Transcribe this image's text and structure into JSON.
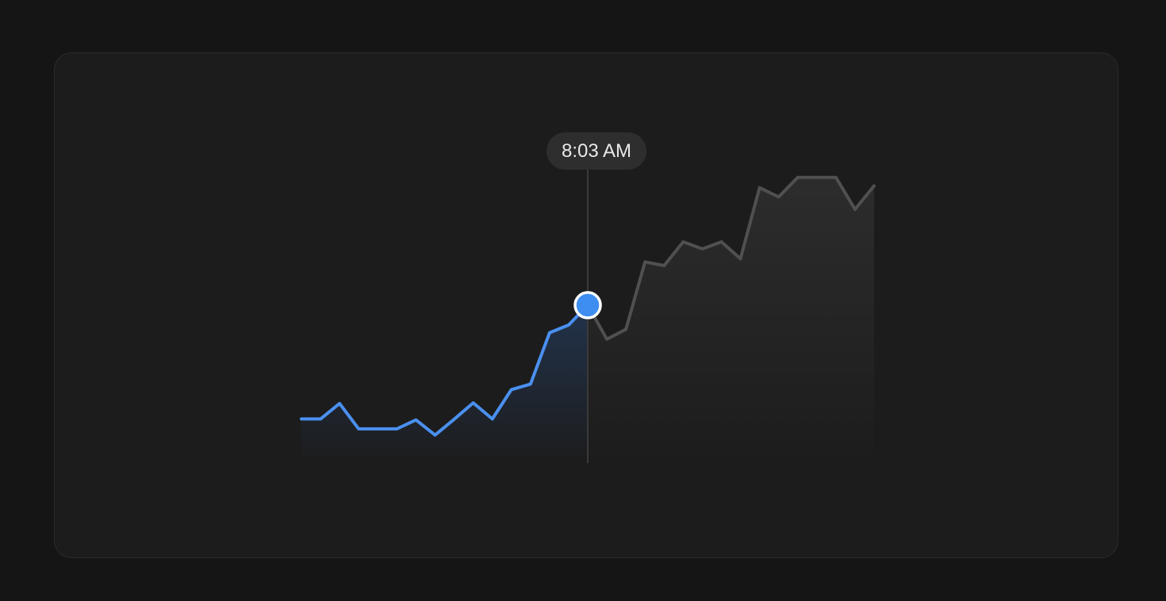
{
  "colors": {
    "page_background": "#151515",
    "card_background": "#1c1c1c",
    "past_line": "#4a90f0",
    "future_line": "#505050",
    "cursor_line": "#3a3a3a",
    "tooltip_background": "#2e2e2e",
    "marker_fill": "#3d8ef0",
    "marker_stroke": "#ffffff"
  },
  "tooltip": {
    "label": "8:03 AM"
  },
  "chart_data": {
    "type": "area",
    "grid": false,
    "axes_visible": false,
    "ylim": [
      0,
      100
    ],
    "highlight_index": 15,
    "values": [
      12.2,
      12.2,
      17.2,
      9.0,
      9.0,
      9.0,
      11.9,
      7.0,
      12.1,
      17.4,
      12.2,
      21.7,
      23.5,
      40.1,
      42.6,
      49.0,
      38.0,
      41.2,
      63.0,
      61.8,
      69.5,
      67.2,
      69.5,
      64.0,
      87.0,
      84.0,
      90.3,
      90.3,
      90.3,
      80.0,
      87.6
    ]
  }
}
